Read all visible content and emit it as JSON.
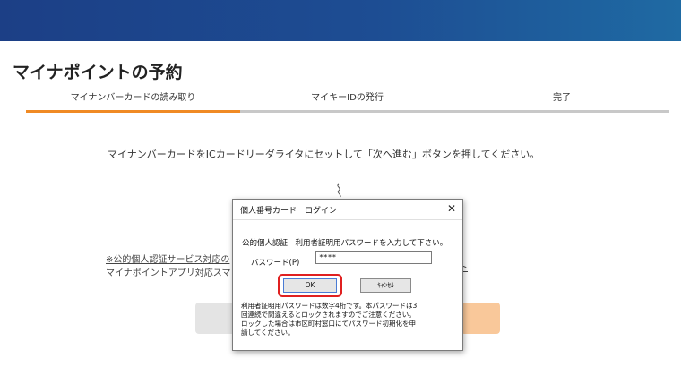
{
  "page": {
    "title": "マイナポイントの予約"
  },
  "steps": [
    {
      "label": "マイナンバーカードの読み取り",
      "active": true
    },
    {
      "label": "マイキーIDの発行",
      "active": false
    },
    {
      "label": "完了",
      "active": false
    }
  ],
  "main": {
    "instruction": "マイナンバーカードをICカードリーダライタにセットして「次へ進む」ボタンを押してください。",
    "note_line1": "※公的個人認証サービス対応の",
    "note_line2": "マイナポイントアプリ対応スマ",
    "note_right": "ト"
  },
  "dialog": {
    "title": "個人番号カード　ログイン",
    "close_symbol": "✕",
    "prompt": "公的個人認証　利用者証明用パスワードを入力して下さい。",
    "password_label": "パスワード(P)",
    "password_value": "****",
    "ok_label": "OK",
    "cancel_label": "ｷｬﾝｾﾙ",
    "info_lines": [
      "利用者証明用パスワードは数字4桁です。本パスワードは3",
      "回連続で間違えるとロックされますのでご注意ください。",
      "ロックした場合は市区町村窓口にてパスワード初期化を申",
      "請してください。"
    ]
  },
  "colors": {
    "banner": "#1d4d93",
    "active_step": "#f08a24",
    "inactive_step": "#c8c8c8",
    "ok_highlight": "#e02020"
  }
}
